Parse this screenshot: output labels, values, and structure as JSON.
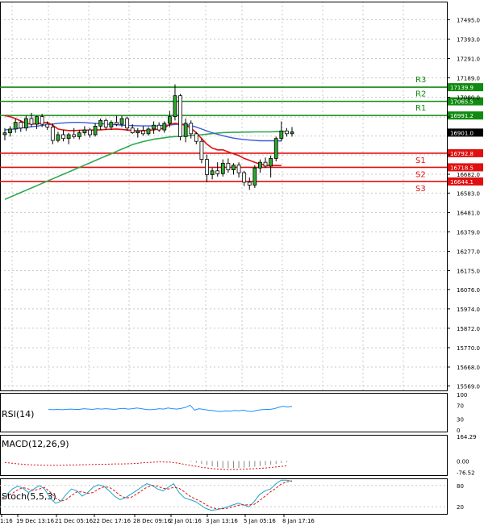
{
  "colors": {
    "grid": "#c8c8c8",
    "axis": "#000000",
    "candle": "#000000",
    "bull_body": "#2fa82f",
    "bear_body": "#ffffff",
    "ma_green": "#2fa84f",
    "ma_red": "#e01010",
    "ma_blue": "#3c5bd8",
    "resistance": "#108a10",
    "support": "#e01010",
    "price_label_bg": "#000000",
    "rsi_line": "#1e8fff",
    "macd_dots": "#e01010",
    "macd_hist": "#888888",
    "stoch_main": "#1aa6c8",
    "stoch_signal": "#e01010"
  },
  "chart_data": {
    "type": "candlestick",
    "price_axis_ticks": [
      17495.0,
      17393.0,
      17291.0,
      17189.0,
      17087.0,
      16983.0,
      16883.0,
      16784.0,
      16682.0,
      16583.0,
      16481.0,
      16379.0,
      16277.0,
      16175.0,
      16076.0,
      15974.0,
      15872.0,
      15770.0,
      15668.0,
      15569.0
    ],
    "price_axis_tick_labels": [
      "17495.0",
      "17393.0",
      "17291.0",
      "17189.0",
      "17080.0",
      "",
      "",
      "",
      "16682.0",
      "16583.0",
      "16481.0",
      "16379.0",
      "16277.0",
      "16175.0",
      "16076.0",
      "15974.0",
      "15872.0",
      "15770.0",
      "15668.0",
      "15569.0"
    ],
    "ylim": [
      15545,
      17590
    ],
    "levels": [
      {
        "name": "R3",
        "value": 17139.9,
        "label": "17139.9",
        "kind": "resistance"
      },
      {
        "name": "R2",
        "value": 17065.5,
        "label": "17065.5",
        "kind": "resistance"
      },
      {
        "name": "R1",
        "value": 16991.2,
        "label": "16991.2",
        "kind": "resistance"
      },
      {
        "name": "S1",
        "value": 16792.8,
        "label": "16792.8",
        "kind": "support"
      },
      {
        "name": "S2",
        "value": 16718.5,
        "label": "16718.5",
        "kind": "support"
      },
      {
        "name": "S3",
        "value": 16644.1,
        "label": "16644.1",
        "kind": "support"
      }
    ],
    "current_price": {
      "value": 16901.0,
      "label": "16901.0"
    },
    "x_ticks": [
      "1:16",
      "19 Dec 13:16",
      "21 Dec 05:16",
      "22 Dec 17:16",
      "28 Dec 09:16",
      "2 Jan 01:16",
      "3 Jan 13:16",
      "5 Jan 05:16",
      "8 Jan 17:16"
    ],
    "candles": [
      {
        "o": 16890,
        "h": 16925,
        "l": 16860,
        "c": 16900
      },
      {
        "o": 16900,
        "h": 16935,
        "l": 16880,
        "c": 16920
      },
      {
        "o": 16920,
        "h": 16975,
        "l": 16900,
        "c": 16955
      },
      {
        "o": 16955,
        "h": 16965,
        "l": 16905,
        "c": 16925
      },
      {
        "o": 16925,
        "h": 16990,
        "l": 16910,
        "c": 16975
      },
      {
        "o": 16975,
        "h": 17005,
        "l": 16930,
        "c": 16945
      },
      {
        "o": 16945,
        "h": 16990,
        "l": 16920,
        "c": 16985
      },
      {
        "o": 16985,
        "h": 17000,
        "l": 16930,
        "c": 16945
      },
      {
        "o": 16945,
        "h": 16960,
        "l": 16915,
        "c": 16930
      },
      {
        "o": 16930,
        "h": 16950,
        "l": 16840,
        "c": 16860
      },
      {
        "o": 16860,
        "h": 16905,
        "l": 16850,
        "c": 16890
      },
      {
        "o": 16890,
        "h": 16915,
        "l": 16855,
        "c": 16870
      },
      {
        "o": 16870,
        "h": 16900,
        "l": 16840,
        "c": 16890
      },
      {
        "o": 16890,
        "h": 16925,
        "l": 16870,
        "c": 16880
      },
      {
        "o": 16880,
        "h": 16915,
        "l": 16865,
        "c": 16900
      },
      {
        "o": 16900,
        "h": 16935,
        "l": 16885,
        "c": 16915
      },
      {
        "o": 16915,
        "h": 16925,
        "l": 16875,
        "c": 16890
      },
      {
        "o": 16890,
        "h": 16950,
        "l": 16880,
        "c": 16935
      },
      {
        "o": 16935,
        "h": 16975,
        "l": 16915,
        "c": 16965
      },
      {
        "o": 16965,
        "h": 16975,
        "l": 16915,
        "c": 16930
      },
      {
        "o": 16930,
        "h": 16965,
        "l": 16915,
        "c": 16955
      },
      {
        "o": 16955,
        "h": 16990,
        "l": 16935,
        "c": 16945
      },
      {
        "o": 16945,
        "h": 16990,
        "l": 16930,
        "c": 16975
      },
      {
        "o": 16975,
        "h": 16985,
        "l": 16910,
        "c": 16925
      },
      {
        "o": 16925,
        "h": 16945,
        "l": 16895,
        "c": 16900
      },
      {
        "o": 16900,
        "h": 16925,
        "l": 16875,
        "c": 16910
      },
      {
        "o": 16910,
        "h": 16935,
        "l": 16885,
        "c": 16895
      },
      {
        "o": 16895,
        "h": 16930,
        "l": 16885,
        "c": 16920
      },
      {
        "o": 16920,
        "h": 16960,
        "l": 16895,
        "c": 16940
      },
      {
        "o": 16940,
        "h": 16955,
        "l": 16905,
        "c": 16915
      },
      {
        "o": 16915,
        "h": 16960,
        "l": 16900,
        "c": 16950
      },
      {
        "o": 16950,
        "h": 17015,
        "l": 16930,
        "c": 16985
      },
      {
        "o": 16985,
        "h": 17155,
        "l": 16965,
        "c": 17095
      },
      {
        "o": 17095,
        "h": 17105,
        "l": 16860,
        "c": 16880
      },
      {
        "o": 16880,
        "h": 16975,
        "l": 16850,
        "c": 16950
      },
      {
        "o": 16950,
        "h": 16965,
        "l": 16870,
        "c": 16895
      },
      {
        "o": 16895,
        "h": 16905,
        "l": 16840,
        "c": 16855
      },
      {
        "o": 16855,
        "h": 16870,
        "l": 16740,
        "c": 16760
      },
      {
        "o": 16760,
        "h": 16785,
        "l": 16640,
        "c": 16680
      },
      {
        "o": 16680,
        "h": 16715,
        "l": 16655,
        "c": 16700
      },
      {
        "o": 16700,
        "h": 16745,
        "l": 16670,
        "c": 16685
      },
      {
        "o": 16685,
        "h": 16760,
        "l": 16670,
        "c": 16740
      },
      {
        "o": 16740,
        "h": 16765,
        "l": 16690,
        "c": 16705
      },
      {
        "o": 16705,
        "h": 16740,
        "l": 16680,
        "c": 16730
      },
      {
        "o": 16730,
        "h": 16745,
        "l": 16665,
        "c": 16690
      },
      {
        "o": 16690,
        "h": 16700,
        "l": 16620,
        "c": 16640
      },
      {
        "o": 16640,
        "h": 16665,
        "l": 16600,
        "c": 16625
      },
      {
        "o": 16625,
        "h": 16730,
        "l": 16610,
        "c": 16715
      },
      {
        "o": 16715,
        "h": 16760,
        "l": 16690,
        "c": 16745
      },
      {
        "o": 16745,
        "h": 16770,
        "l": 16715,
        "c": 16725
      },
      {
        "o": 16725,
        "h": 16780,
        "l": 16665,
        "c": 16765
      },
      {
        "o": 16765,
        "h": 16880,
        "l": 16750,
        "c": 16870
      },
      {
        "o": 16870,
        "h": 16960,
        "l": 16855,
        "c": 16910
      },
      {
        "o": 16910,
        "h": 16925,
        "l": 16880,
        "c": 16895
      },
      {
        "o": 16895,
        "h": 16930,
        "l": 16880,
        "c": 16905
      }
    ],
    "ma_green": [
      16550,
      16562,
      16574,
      16586,
      16598,
      16610,
      16622,
      16634,
      16646,
      16658,
      16670,
      16682,
      16694,
      16706,
      16718,
      16730,
      16742,
      16754,
      16766,
      16778,
      16790,
      16802,
      16814,
      16826,
      16838,
      16846,
      16854,
      16860,
      16866,
      16870,
      16874,
      16878,
      16880,
      16882,
      16884,
      16886,
      16888,
      16890,
      16893,
      16896,
      16899,
      16901,
      16902,
      16903,
      16903,
      16904,
      16904,
      16905,
      16905,
      16905,
      16905,
      16906,
      16906,
      16906
    ],
    "ma_red": [
      16990,
      16985,
      16975,
      16962,
      16950,
      16945,
      16948,
      16952,
      16955,
      16940,
      16920,
      16915,
      16912,
      16912,
      16913,
      16914,
      16914,
      16915,
      16916,
      16918,
      16919,
      16920,
      16918,
      16915,
      16912,
      16910,
      16912,
      16913,
      16916,
      16920,
      16925,
      16945,
      16950,
      16945,
      16940,
      16925,
      16900,
      16870,
      16840,
      16820,
      16810,
      16810,
      16800,
      16790,
      16780,
      16765,
      16755,
      16745,
      16735,
      16730,
      16728,
      16728,
      16728
    ],
    "ma_blue": [
      16915,
      16918,
      16921,
      16925,
      16928,
      16932,
      16935,
      16939,
      16942,
      16946,
      16950,
      16952,
      16954,
      16955,
      16955,
      16954,
      16952,
      16950,
      16948,
      16946,
      16944,
      16942,
      16940,
      16939,
      16938,
      16937,
      16936,
      16936,
      16936,
      16937,
      16939,
      16941,
      16944,
      16946,
      16944,
      16938,
      16930,
      16920,
      16910,
      16900,
      16892,
      16885,
      16878,
      16872,
      16868,
      16865,
      16862,
      16860,
      16858,
      16858,
      16858,
      16858,
      16857
    ],
    "rsi": {
      "label": "RSI(14)",
      "ticks": [
        100,
        70,
        30,
        0
      ],
      "values": [
        58,
        57,
        58,
        57,
        58,
        59,
        58,
        58,
        60,
        59,
        58,
        60,
        59,
        60,
        59,
        58,
        60,
        61,
        59,
        60,
        62,
        60,
        58,
        57,
        58,
        60,
        59,
        62,
        60,
        59,
        61,
        64,
        70,
        56,
        60,
        58,
        56,
        55,
        53,
        52,
        54,
        53,
        55,
        54,
        56,
        53,
        52,
        55,
        57,
        58,
        58,
        60,
        64,
        67,
        65,
        67
      ]
    },
    "macd": {
      "label": "MACD(12,26,9)",
      "ticks": [
        164.29,
        0.0,
        -76.52
      ],
      "tick_labels": [
        "164.29",
        "0.00",
        "-76.52"
      ],
      "signal": [
        -10,
        -14,
        -18,
        -21,
        -24,
        -26,
        -27,
        -28,
        -29,
        -29,
        -29,
        -28,
        -27,
        -27,
        -26,
        -25,
        -24,
        -23,
        -22,
        -22,
        -21,
        -20,
        -20,
        -19,
        -18,
        -16,
        -12,
        -10,
        -8,
        -6,
        -7,
        -8,
        -12,
        -18,
        -24,
        -30,
        -36,
        -42,
        -47,
        -51,
        -54,
        -56,
        -57,
        -57,
        -56,
        -55,
        -53,
        -51,
        -49,
        -47,
        -44,
        -40,
        -36,
        -32
      ],
      "histogram": [
        0,
        0,
        0,
        0,
        0,
        0,
        0,
        0,
        0,
        0,
        0,
        0,
        0,
        0,
        0,
        0,
        0,
        0,
        0,
        0,
        0,
        0,
        0,
        0,
        0,
        0,
        0,
        0,
        0,
        0,
        0,
        0,
        0,
        0,
        0,
        -5,
        -12,
        -20,
        -28,
        -36,
        -42,
        -46,
        -48,
        -48,
        -47,
        -45,
        -42,
        -38,
        -34,
        -30,
        -26,
        -20,
        -14,
        -8
      ]
    },
    "stoch": {
      "label": "Stoch(5,5,3)",
      "ticks": [
        80,
        20
      ],
      "main": [
        40,
        55,
        70,
        78,
        72,
        60,
        70,
        80,
        70,
        45,
        30,
        35,
        55,
        70,
        65,
        50,
        60,
        75,
        82,
        78,
        65,
        50,
        40,
        45,
        55,
        65,
        75,
        85,
        80,
        70,
        65,
        75,
        85,
        60,
        45,
        40,
        35,
        25,
        15,
        10,
        12,
        15,
        20,
        25,
        30,
        25,
        20,
        35,
        55,
        65,
        70,
        85,
        95,
        95,
        92
      ],
      "signal": [
        45,
        50,
        58,
        68,
        74,
        70,
        66,
        70,
        74,
        62,
        45,
        36,
        40,
        52,
        62,
        62,
        58,
        60,
        70,
        76,
        75,
        65,
        52,
        45,
        46,
        55,
        65,
        75,
        80,
        78,
        72,
        70,
        75,
        72,
        62,
        50,
        42,
        35,
        26,
        18,
        14,
        14,
        16,
        20,
        24,
        26,
        25,
        27,
        38,
        50,
        62,
        72,
        84,
        90,
        93
      ]
    }
  }
}
